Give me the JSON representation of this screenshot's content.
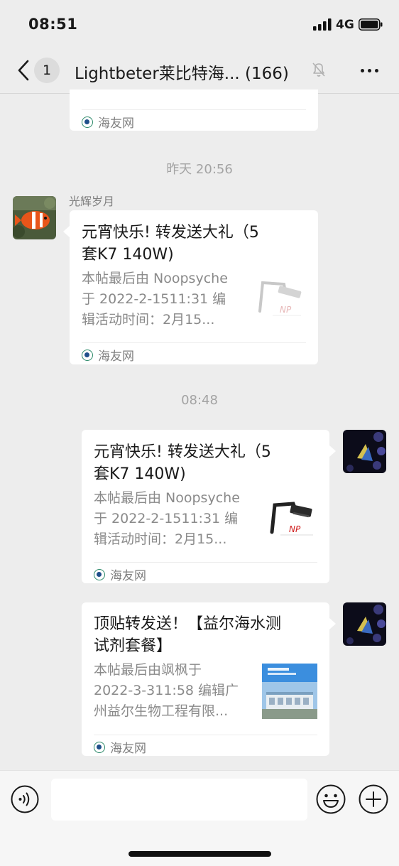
{
  "status_bar": {
    "time": "08:51",
    "network": "4G"
  },
  "nav": {
    "unread_count": "1",
    "title": "Lightbeter莱比特海...",
    "member_count": "(166)"
  },
  "messages": [
    {
      "source": "海友网"
    },
    {
      "timestamp": "昨天 20:56"
    },
    {
      "sender": "光辉岁月",
      "title_line1": "元宵快乐! 转发送大礼（5",
      "title_line2": "套K7  140W)",
      "desc_line1": "本帖最后由 Noopsyche",
      "desc_line2": "于 2022-2-1511:31 编",
      "desc_line3": "辑活动时间：2月15...",
      "source": "海友网"
    },
    {
      "timestamp": "08:48"
    },
    {
      "title_line1": "元宵快乐! 转发送大礼（5",
      "title_line2": "套K7  140W)",
      "desc_line1": "本帖最后由 Noopsyche",
      "desc_line2": "于 2022-2-1511:31 编",
      "desc_line3": "辑活动时间：2月15...",
      "source": "海友网"
    },
    {
      "title_line1": "顶贴转发送！【益尔海水测",
      "title_line2": "试剂套餐】",
      "desc_line1": "本帖最后由飒枫于",
      "desc_line2": "2022-3-311:58 编辑广",
      "desc_line3": "州益尔生物工程有限...",
      "source": "海友网"
    }
  ],
  "input": {
    "placeholder": ""
  },
  "colors": {
    "background": "#ededed",
    "card": "#ffffff",
    "muted": "#8a8a8a",
    "source_icon": "#2d8a6a"
  },
  "icons": [
    "signal-icon",
    "battery-icon",
    "back-icon",
    "mute-icon",
    "more-icon",
    "voice-icon",
    "emoji-icon",
    "plus-icon"
  ]
}
